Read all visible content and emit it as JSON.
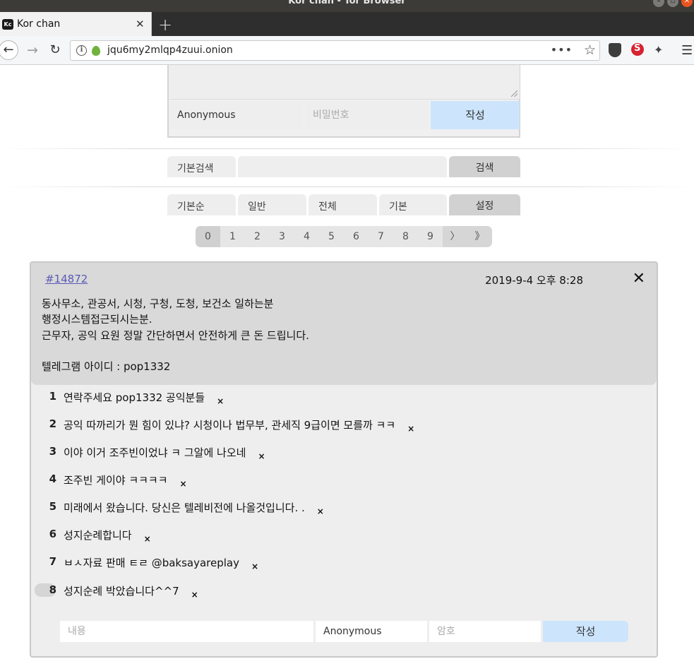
{
  "window": {
    "title": "Kor chan - Tor Browser",
    "controls": [
      "minimize",
      "maximize",
      "close"
    ]
  },
  "browser": {
    "tab": {
      "title": "Kor chan",
      "favicon_text": "Kc",
      "close_glyph": "✕"
    },
    "new_tab_glyph": "+",
    "url": "jqu6my2mlqp4zuui.onion",
    "icons": [
      "back-arrow-icon",
      "forward-arrow-icon",
      "reload-icon",
      "info-icon",
      "onion-icon",
      "page-actions-icon",
      "bookmark-star-icon",
      "shield-icon",
      "noscript-icon",
      "magic-wand-icon",
      "hamburger-menu-icon"
    ]
  },
  "post_form": {
    "name_value": "Anonymous",
    "password_placeholder": "비밀번호",
    "submit_label": "작성"
  },
  "search_bar": {
    "mode_label": "기본검색",
    "input_value": "",
    "button_label": "검색"
  },
  "filter_bar": {
    "sort_label": "기본순",
    "type_label": "일반",
    "scope_label": "전체",
    "view_label": "기본",
    "settings_label": "설정"
  },
  "pagination": {
    "pages": [
      "0",
      "1",
      "2",
      "3",
      "4",
      "5",
      "6",
      "7",
      "8",
      "9"
    ],
    "current": "0",
    "next_glyph": "〉",
    "last_glyph": "》"
  },
  "thread": {
    "post_number": "#14872",
    "date": "2019-9-4 오후 8:28",
    "close_glyph": "✕",
    "body_lines": [
      "동사무소, 관공서, 시청, 구청, 도청, 보건소 일하는분",
      "행정시스템접근되시는분.",
      "근무자, 공익 요원 정말 간단하면서 안전하게 큰 돈 드립니다.",
      "텔레그램 아이디 : pop1332"
    ],
    "replies": [
      {
        "num": "1",
        "text": "연락주세요 pop1332 공익분들"
      },
      {
        "num": "2",
        "text": "공익 따까리가 뭔 힘이 있냐? 시청이나 법무부, 관세직 9급이면 모를까 ㅋㅋ"
      },
      {
        "num": "3",
        "text": "이야 이거 조주빈이었냐 ㅋ 그알에 나오네"
      },
      {
        "num": "4",
        "text": "조주빈 게이야 ㅋㅋㅋㅋ"
      },
      {
        "num": "5",
        "text": "미래에서 왔습니다. 당신은 텔레비전에 나올것입니다. ."
      },
      {
        "num": "6",
        "text": "성지순례합니다"
      },
      {
        "num": "7",
        "text": "ㅂㅅ자료 판매 ㅌㄹ @baksayareplay"
      },
      {
        "num": "8",
        "text": "성지순례 박았습니다^^7"
      }
    ],
    "delete_glyph": "×",
    "reply_form": {
      "content_placeholder": "내용",
      "name_value": "Anonymous",
      "password_placeholder": "암호",
      "submit_label": "작성"
    }
  }
}
